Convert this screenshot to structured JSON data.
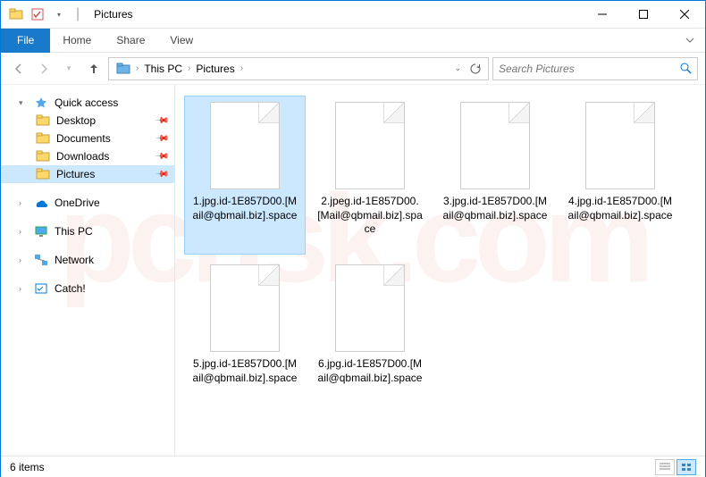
{
  "window": {
    "title": "Pictures",
    "min_tooltip": "Minimize",
    "max_tooltip": "Maximize",
    "close_tooltip": "Close"
  },
  "ribbon": {
    "file": "File",
    "tabs": [
      "Home",
      "Share",
      "View"
    ]
  },
  "breadcrumb": {
    "segments": [
      "This PC",
      "Pictures"
    ]
  },
  "search": {
    "placeholder": "Search Pictures"
  },
  "sidebar": {
    "quick_access": "Quick access",
    "items": [
      {
        "label": "Desktop",
        "pinned": true
      },
      {
        "label": "Documents",
        "pinned": true
      },
      {
        "label": "Downloads",
        "pinned": true
      },
      {
        "label": "Pictures",
        "pinned": true,
        "selected": true
      }
    ],
    "roots": [
      {
        "label": "OneDrive"
      },
      {
        "label": "This PC"
      },
      {
        "label": "Network"
      },
      {
        "label": "Catch!"
      }
    ]
  },
  "files": [
    {
      "name": "1.jpg.id-1E857D00.[Mail@qbmail.biz].space",
      "selected": true
    },
    {
      "name": "2.jpeg.id-1E857D00.[Mail@qbmail.biz].space"
    },
    {
      "name": "3.jpg.id-1E857D00.[Mail@qbmail.biz].space"
    },
    {
      "name": "4.jpg.id-1E857D00.[Mail@qbmail.biz].space"
    },
    {
      "name": "5.jpg.id-1E857D00.[Mail@qbmail.biz].space"
    },
    {
      "name": "6.jpg.id-1E857D00.[Mail@qbmail.biz].space"
    }
  ],
  "status": {
    "count": "6 items"
  }
}
